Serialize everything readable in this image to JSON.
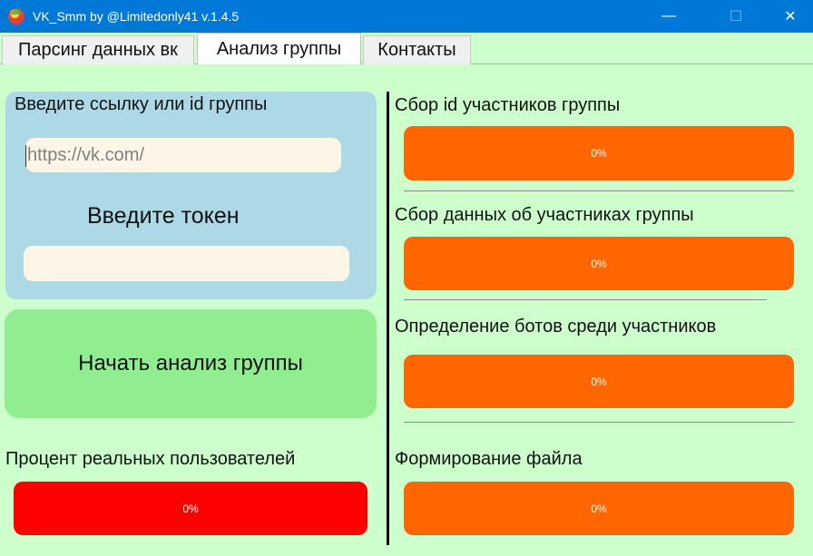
{
  "window": {
    "title": "VK_Smm by @Limitedonly41 v.1.4.5",
    "minimize_glyph": "—",
    "maximize_glyph": "☐",
    "close_glyph": "✕"
  },
  "tabs": [
    {
      "label": "Парсинг данных вк",
      "active": false
    },
    {
      "label": "Анализ группы",
      "active": true
    },
    {
      "label": "Контакты",
      "active": false
    }
  ],
  "left": {
    "link_label": "Введите ссылку или id группы",
    "link_placeholder": "https://vk.com/",
    "link_value": "",
    "token_label": "Введите токен",
    "token_value": "",
    "start_button": "Начать анализ группы",
    "real_percent_label": "Процент реальных пользователей",
    "real_percent": {
      "value": 0,
      "text": "0%"
    }
  },
  "right": {
    "stages": [
      {
        "label": "Сбор id участников группы",
        "value": 0,
        "text": "0%"
      },
      {
        "label": "Сбор данных об участниках группы",
        "value": 0,
        "text": "0%"
      },
      {
        "label": "Определение ботов среди участников",
        "value": 0,
        "text": "0%"
      },
      {
        "label": "Формирование файла",
        "value": 0,
        "text": "0%"
      }
    ]
  },
  "colors": {
    "background": "#ccffcc",
    "titlebar": "#0078d7",
    "input_panel": "#add8e6",
    "input_field": "#fdf5e6",
    "start_button": "#90ee90",
    "progress_orange": "#ff6600",
    "progress_red": "#ff0000"
  }
}
